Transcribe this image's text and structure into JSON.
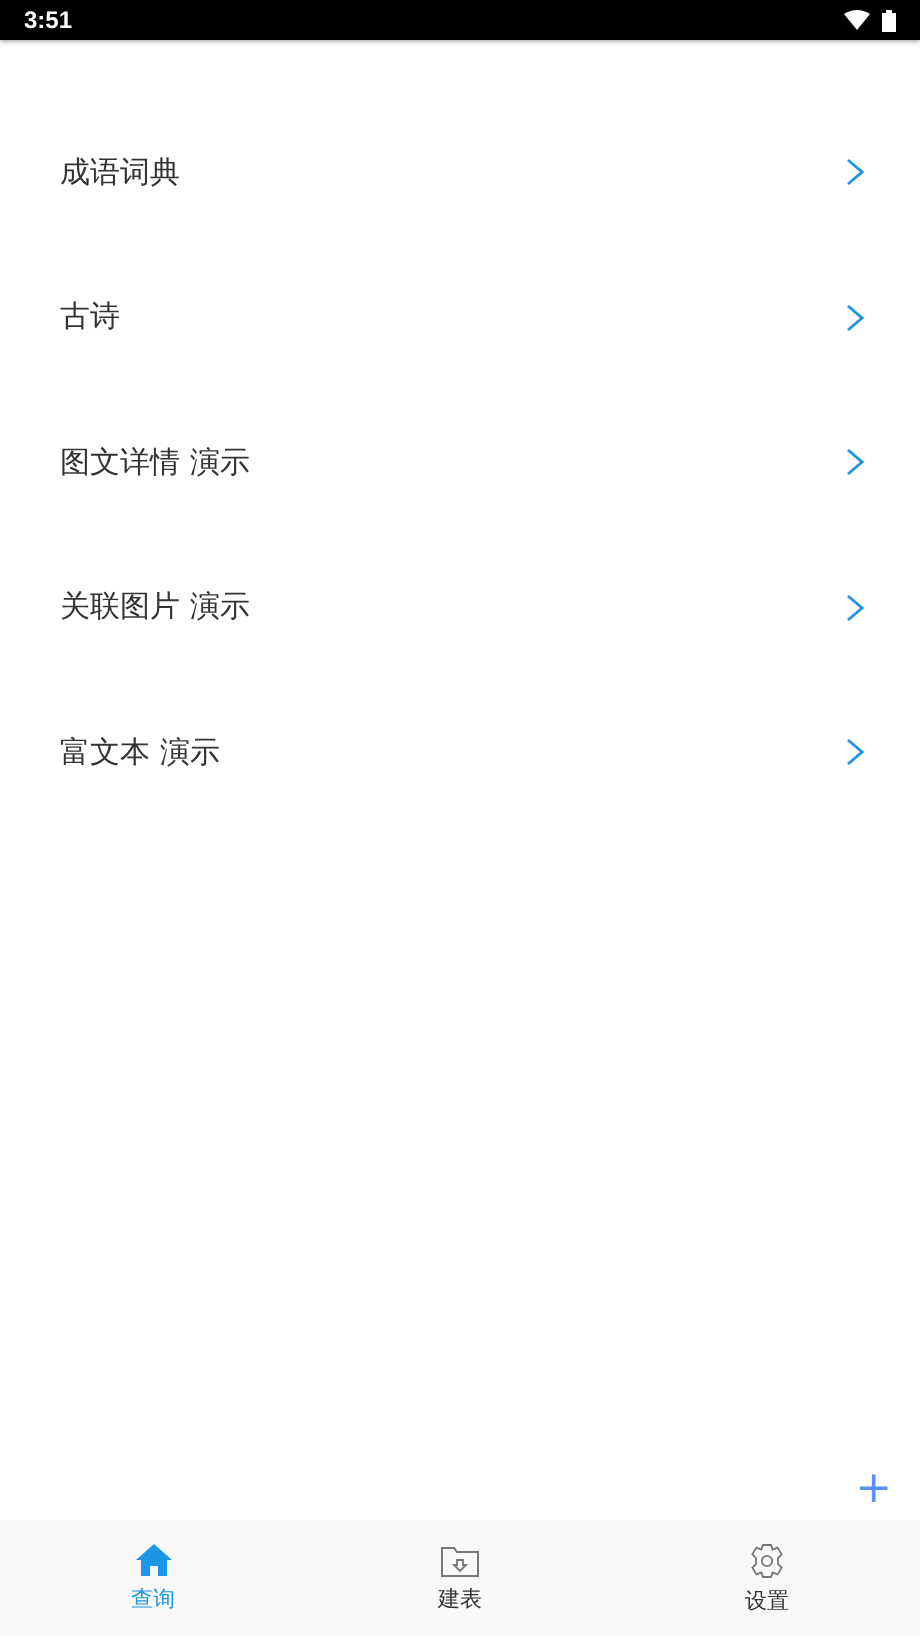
{
  "status_bar": {
    "time": "3:51"
  },
  "menu_items": [
    {
      "label": "成语词典"
    },
    {
      "label": "古诗"
    },
    {
      "label": "图文详情 演示"
    },
    {
      "label": "关联图片 演示"
    },
    {
      "label": "富文本 演示"
    }
  ],
  "add_button": {
    "label": "+"
  },
  "tabs": [
    {
      "kind": "home",
      "label": "查询",
      "selected": true
    },
    {
      "kind": "folder",
      "label": "建表",
      "selected": false
    },
    {
      "kind": "gear",
      "label": "设置",
      "selected": false
    }
  ]
}
